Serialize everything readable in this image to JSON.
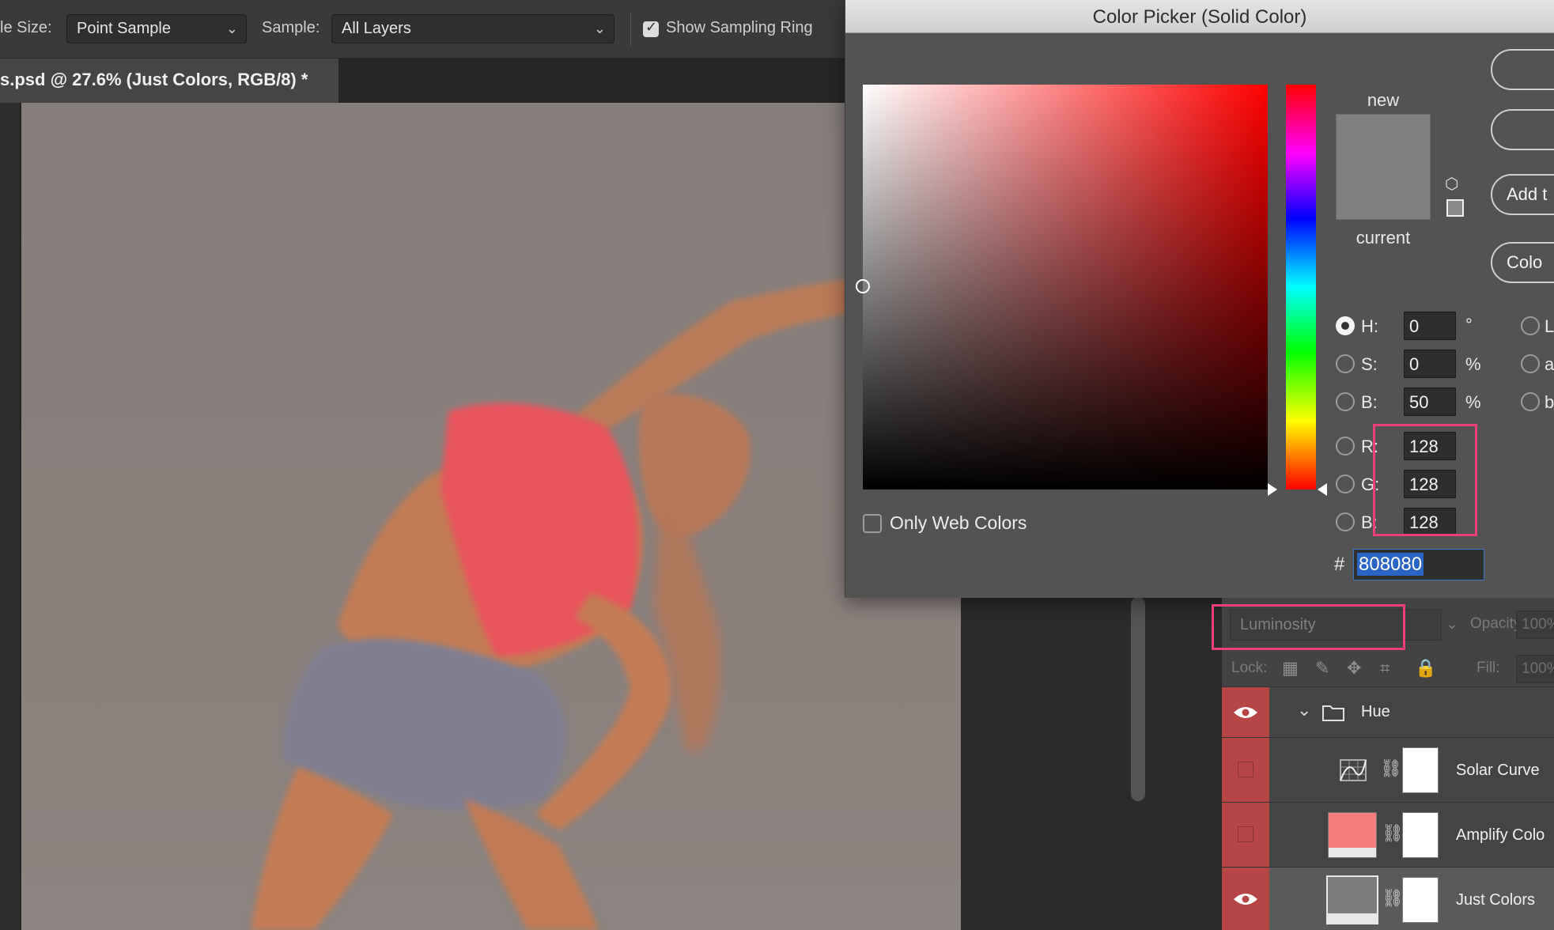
{
  "options_bar": {
    "sample_size_label": "le Size:",
    "sample_size_value": "Point Sample",
    "sample_label": "Sample:",
    "sample_value": "All Layers",
    "show_sampling_ring_label": "Show Sampling Ring",
    "show_sampling_ring_checked": true
  },
  "document": {
    "tab_title": "s.psd @ 27.6% (Just Colors, RGB/8) *"
  },
  "color_picker": {
    "title": "Color Picker (Solid Color)",
    "new_label": "new",
    "current_label": "current",
    "swatch_color": "#808080",
    "buttons": [
      "",
      "",
      "Add t",
      "Colo"
    ],
    "fields": [
      {
        "label": "H:",
        "value": "0",
        "unit": "°",
        "selected": true
      },
      {
        "label": "S:",
        "value": "0",
        "unit": "%",
        "selected": false
      },
      {
        "label": "B:",
        "value": "50",
        "unit": "%",
        "selected": false
      },
      {
        "label": "R:",
        "value": "128",
        "unit": "",
        "selected": false
      },
      {
        "label": "G:",
        "value": "128",
        "unit": "",
        "selected": false
      },
      {
        "label": "B:",
        "value": "128",
        "unit": "",
        "selected": false
      }
    ],
    "lab_fields": [
      "L",
      "a",
      "b"
    ],
    "hex_symbol": "#",
    "hex_value": "808080",
    "only_web_colors_label": "Only Web Colors",
    "only_web_colors_checked": false,
    "highlight_color": "#ec3f7c"
  },
  "layers_panel": {
    "blend_mode": "Luminosity",
    "opacity_label": "Opacity:",
    "opacity_value": "100%",
    "lock_label": "Lock:",
    "fill_label": "Fill:",
    "fill_value": "100%",
    "eye_column_color": "#b64545",
    "layers": [
      {
        "name": "Hue",
        "type": "group",
        "visible": true
      },
      {
        "name": "Solar Curve",
        "type": "curves-adjustment",
        "visible": false
      },
      {
        "name": "Amplify Colo",
        "type": "solid-color-fill",
        "visible": false,
        "thumb_color": "#f47c7c"
      },
      {
        "name": "Just Colors",
        "type": "solid-color-fill",
        "visible": true,
        "thumb_color": "#7c7c7c",
        "selected": true
      }
    ]
  }
}
